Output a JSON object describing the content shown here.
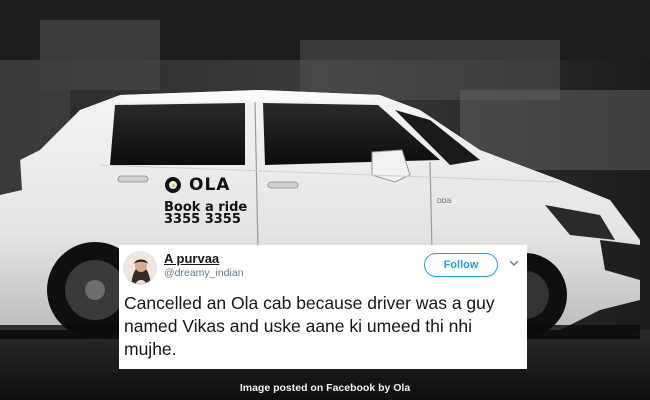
{
  "photo": {
    "car_brand_text": "OLA",
    "car_book_text": "Book a ride",
    "car_phone_text": "3355 3355",
    "car_badge_text": "DDiS"
  },
  "tweet": {
    "display_name": "A purvaa",
    "handle": "@dreamy_indian",
    "follow_label": "Follow",
    "text": "Cancelled an Ola cab because driver was a guy named Vikas and uske aane ki umeed thi nhi mujhe."
  },
  "caption": "Image posted on Facebook by Ola",
  "colors": {
    "follow_blue": "#1da1f2",
    "tweet_text": "#14171a",
    "handle_grey": "#657786"
  },
  "icons": [
    "ola-logo-icon",
    "chevron-down-icon",
    "avatar"
  ]
}
